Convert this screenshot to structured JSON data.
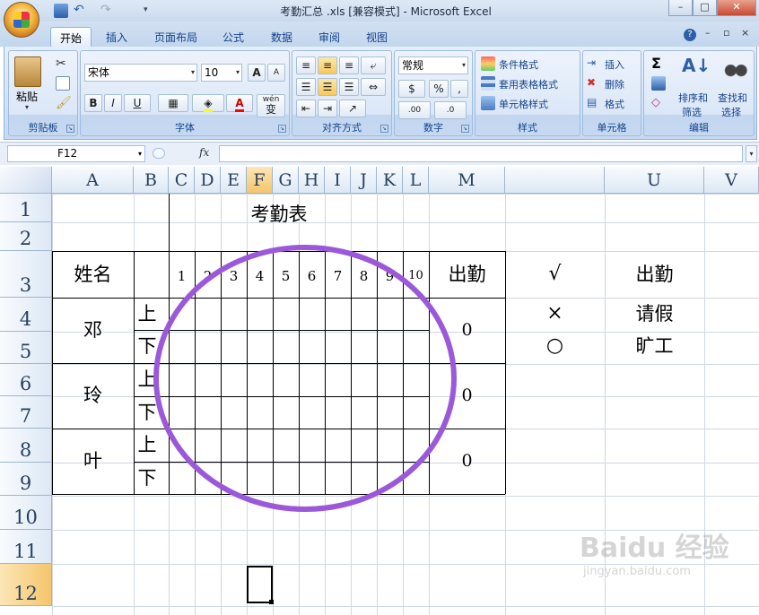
{
  "window": {
    "title": "考勤汇总 .xls  [兼容模式] - Microsoft Excel",
    "minimize": "–",
    "maximize": "□",
    "close": "✕"
  },
  "ribbon": {
    "tabs": [
      "开始",
      "插入",
      "页面布局",
      "公式",
      "数据",
      "审阅",
      "视图"
    ],
    "active_tab": "开始",
    "clipboard": {
      "paste": "粘贴",
      "label": "剪贴板"
    },
    "font": {
      "name": "宋体",
      "size": "10",
      "bold": "B",
      "italic": "I",
      "underline": "U",
      "grow": "A",
      "shrink": "A",
      "label": "字体",
      "wen": "wén",
      "bian": "变"
    },
    "alignment": {
      "label": "对齐方式"
    },
    "number": {
      "format": "常规",
      "percent": "%",
      "comma": ",",
      "inc": ".00",
      "dec": ".0",
      "label": "数字"
    },
    "styles": {
      "conditional": "条件格式",
      "table": "套用表格格式",
      "cell_styles": "单元格样式",
      "label": "样式"
    },
    "cells": {
      "insert": "插入",
      "delete": "删除",
      "format": "格式",
      "label": "单元格"
    },
    "editing": {
      "sigma": "Σ",
      "sort": "排序和",
      "sort2": "筛选",
      "find": "查找和",
      "find2": "选择",
      "label": "编辑"
    }
  },
  "formula_bar": {
    "name_box": "F12",
    "fx": "fx",
    "formula": ""
  },
  "columns": [
    "A",
    "B",
    "C",
    "D",
    "E",
    "F",
    "G",
    "H",
    "I",
    "J",
    "K",
    "L",
    "M",
    "",
    "U",
    "V"
  ],
  "rows": [
    "1",
    "2",
    "3",
    "4",
    "5",
    "6",
    "7",
    "8",
    "9",
    "10",
    "11",
    "12"
  ],
  "selected": {
    "column": "F",
    "row": "12"
  },
  "sheet": {
    "title": "考勤表",
    "header_name": "姓名",
    "days": [
      "1",
      "2",
      "3",
      "4",
      "5",
      "6",
      "7",
      "8",
      "9",
      "10"
    ],
    "header_attendance": "出勤",
    "employees": [
      {
        "name": "邓",
        "am": "上",
        "pm": "下",
        "attendance": "0"
      },
      {
        "name": "玲",
        "am": "上",
        "pm": "下",
        "attendance": "0"
      },
      {
        "name": "叶",
        "am": "上",
        "pm": "下",
        "attendance": "0"
      }
    ],
    "legend": [
      {
        "symbol": "√",
        "meaning": "出勤"
      },
      {
        "symbol": "×",
        "meaning": "请假"
      },
      {
        "symbol": "○",
        "meaning": "旷工"
      }
    ]
  },
  "annotation": {
    "color": "#9b59d9",
    "shape": "circle"
  },
  "watermark": {
    "text": "Baidu 经验",
    "url": "jingyan.baidu.com"
  }
}
